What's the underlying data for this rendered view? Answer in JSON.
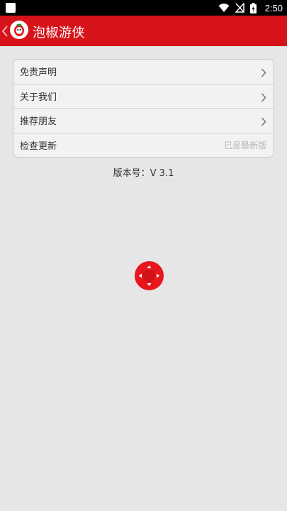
{
  "status_bar": {
    "time": "2:50",
    "icons": [
      "notification-icon",
      "wifi-icon",
      "no-sim-icon",
      "battery-icon"
    ]
  },
  "header": {
    "back_icon": "chevron-left-icon",
    "logo_icon": "pepper-logo-icon",
    "title": "泡椒游侠",
    "background_color": "#d7131a"
  },
  "menu": {
    "items": [
      {
        "label": "免责声明",
        "value": "",
        "trailing_icon": "chevron-right-icon"
      },
      {
        "label": "关于我们",
        "value": "",
        "trailing_icon": "chevron-right-icon"
      },
      {
        "label": "推荐朋友",
        "value": "",
        "trailing_icon": "chevron-right-icon"
      },
      {
        "label": "检查更新",
        "value": "已是最新版",
        "trailing_icon": ""
      }
    ]
  },
  "version_text": "版本号：V 3.1",
  "floating_button": {
    "icon": "dpad-icon",
    "color": "#e8171d"
  }
}
